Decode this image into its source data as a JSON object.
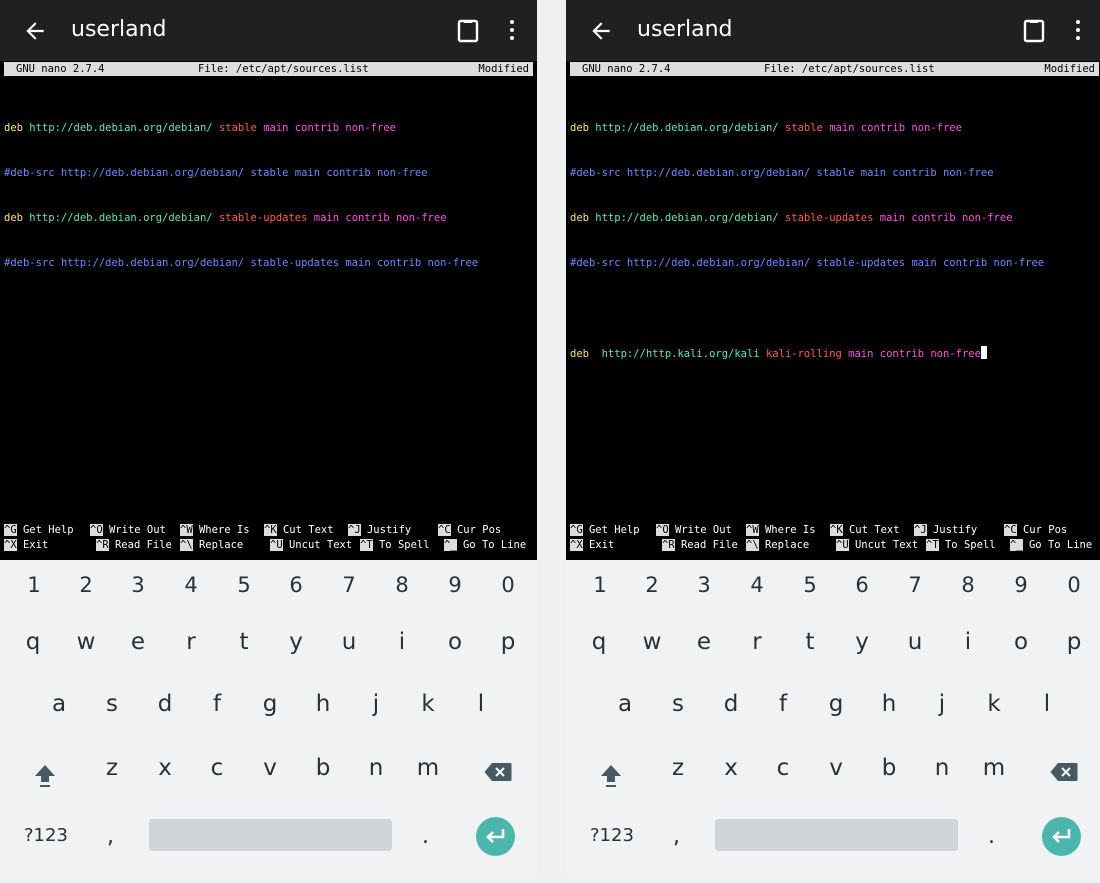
{
  "app": {
    "title": "userland"
  },
  "icons": {
    "back": "arrow-left-icon",
    "clipboard": "clipboard-icon",
    "menu": "more-vertical-icon",
    "shift": "shift-icon",
    "backspace": "backspace-icon",
    "enter": "enter-icon"
  },
  "colors": {
    "appbar": "#202020",
    "terminal": "#000000",
    "keyboard": "#f0f2f3",
    "accent": "#4db6ac"
  },
  "nano": {
    "version": "GNU nano 2.7.4",
    "file": "File: /etc/apt/sources.list",
    "status": "Modified"
  },
  "left": {
    "lines": [
      {
        "a": "deb",
        "b": " http://deb.debian.org/debian/ ",
        "c": "stable",
        "d": " main contrib non-free"
      },
      {
        "a": "#deb-src http://deb.debian.org/debian/ stable main contrib non-free"
      },
      {
        "a": "deb",
        "b": " http://deb.debian.org/debian/ ",
        "c": "stable-updates",
        "d": " main contrib non-free"
      },
      {
        "a": "#deb-src http://deb.debian.org/debian/ stable-updates main contrib non-free"
      }
    ]
  },
  "right": {
    "lines": [
      {
        "a": "deb",
        "b": " http://deb.debian.org/debian/ ",
        "c": "stable",
        "d": " main contrib non-free"
      },
      {
        "a": "#deb-src http://deb.debian.org/debian/ stable main contrib non-free"
      },
      {
        "a": "deb",
        "b": " http://deb.debian.org/debian/ ",
        "c": "stable-updates",
        "d": " main contrib non-free"
      },
      {
        "a": "#deb-src http://deb.debian.org/debian/ stable-updates main contrib non-free"
      }
    ],
    "kali": {
      "a": "deb",
      "b": "  http://http.kali.org/kali ",
      "c": "kali-rolling",
      "d": " main contrib non-free"
    }
  },
  "shortcuts": {
    "row1": [
      {
        "key": "^G",
        "label": " Get Help"
      },
      {
        "key": "^O",
        "label": " Write Out"
      },
      {
        "key": "^W",
        "label": " Where Is"
      },
      {
        "key": "^K",
        "label": " Cut Text"
      },
      {
        "key": "^J",
        "label": " Justify"
      },
      {
        "key": "^C",
        "label": " Cur Pos"
      }
    ],
    "row2": [
      {
        "key": "^X",
        "label": " Exit"
      },
      {
        "key": "^R",
        "label": " Read File"
      },
      {
        "key": "^\\",
        "label": " Replace"
      },
      {
        "key": "^U",
        "label": " Uncut Text"
      },
      {
        "key": "^T",
        "label": " To Spell"
      },
      {
        "key": "^_",
        "label": " Go To Line"
      }
    ]
  },
  "keyboard": {
    "numbers": [
      "1",
      "2",
      "3",
      "4",
      "5",
      "6",
      "7",
      "8",
      "9",
      "0"
    ],
    "row1": [
      "q",
      "w",
      "e",
      "r",
      "t",
      "y",
      "u",
      "i",
      "o",
      "p"
    ],
    "row2": [
      "a",
      "s",
      "d",
      "f",
      "g",
      "h",
      "j",
      "k",
      "l"
    ],
    "row3": [
      "z",
      "x",
      "c",
      "v",
      "b",
      "n",
      "m"
    ],
    "symbols": "?123",
    "comma": ",",
    "period": "."
  }
}
